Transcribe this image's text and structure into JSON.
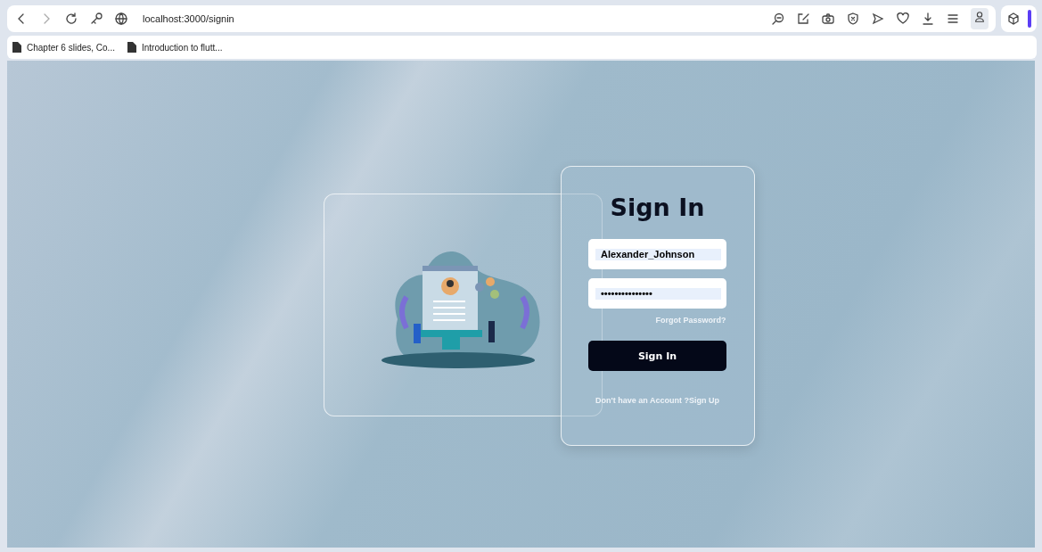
{
  "browser": {
    "address": "localhost:3000/signin",
    "bookmarks": [
      "Chapter 6 slides, Co...",
      "Introduction to flutt..."
    ]
  },
  "signin": {
    "title": "Sign In",
    "username": {
      "value": "Alexander_Johnson"
    },
    "password": {
      "value": "•••••••••••••••"
    },
    "forgot_link": "Forgot Password?",
    "submit": "Sign In",
    "signup_prompt": "Don't have an Account ?",
    "signup_link": "Sign Up"
  }
}
